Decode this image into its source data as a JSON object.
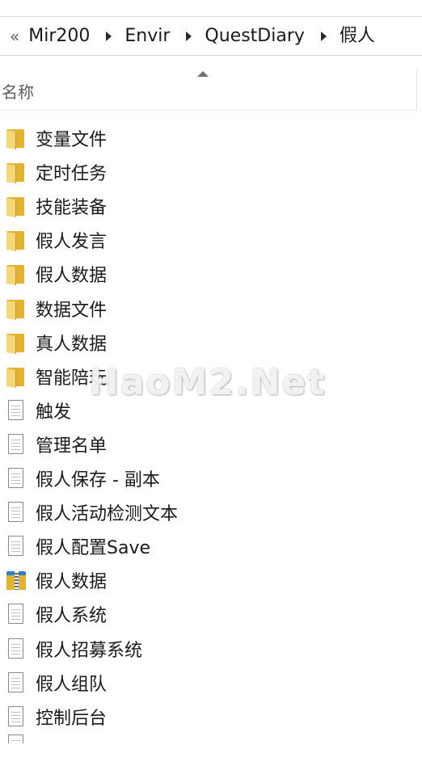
{
  "address_bar": {
    "overflow_glyph": "«",
    "crumbs": [
      "Mir200",
      "Envir",
      "QuestDiary",
      "假人"
    ]
  },
  "column_header": {
    "name_label": "名称"
  },
  "watermark": "HaoM2.Net",
  "items": [
    {
      "type": "folder",
      "label": "变量文件"
    },
    {
      "type": "folder",
      "label": "定时任务"
    },
    {
      "type": "folder",
      "label": "技能装备"
    },
    {
      "type": "folder",
      "label": "假人发言"
    },
    {
      "type": "folder",
      "label": "假人数据"
    },
    {
      "type": "folder",
      "label": "数据文件"
    },
    {
      "type": "folder",
      "label": "真人数据"
    },
    {
      "type": "folder",
      "label": "智能陪玩"
    },
    {
      "type": "text-file",
      "label": "触发"
    },
    {
      "type": "text-file",
      "label": "管理名单"
    },
    {
      "type": "text-file",
      "label": "假人保存 - 副本"
    },
    {
      "type": "text-file",
      "label": "假人活动检测文本"
    },
    {
      "type": "text-file",
      "label": "假人配置Save"
    },
    {
      "type": "zip-folder",
      "label": "假人数据"
    },
    {
      "type": "text-file",
      "label": "假人系统"
    },
    {
      "type": "text-file",
      "label": "假人招募系统"
    },
    {
      "type": "text-file",
      "label": "假人组队"
    },
    {
      "type": "text-file",
      "label": "控制后台"
    }
  ],
  "icons": {
    "folder": "folder-icon",
    "text-file": "text-file-icon",
    "zip-folder": "zip-folder-icon"
  },
  "colors": {
    "folder": "#e2b332",
    "zip_accent": "#2f7fd0"
  }
}
